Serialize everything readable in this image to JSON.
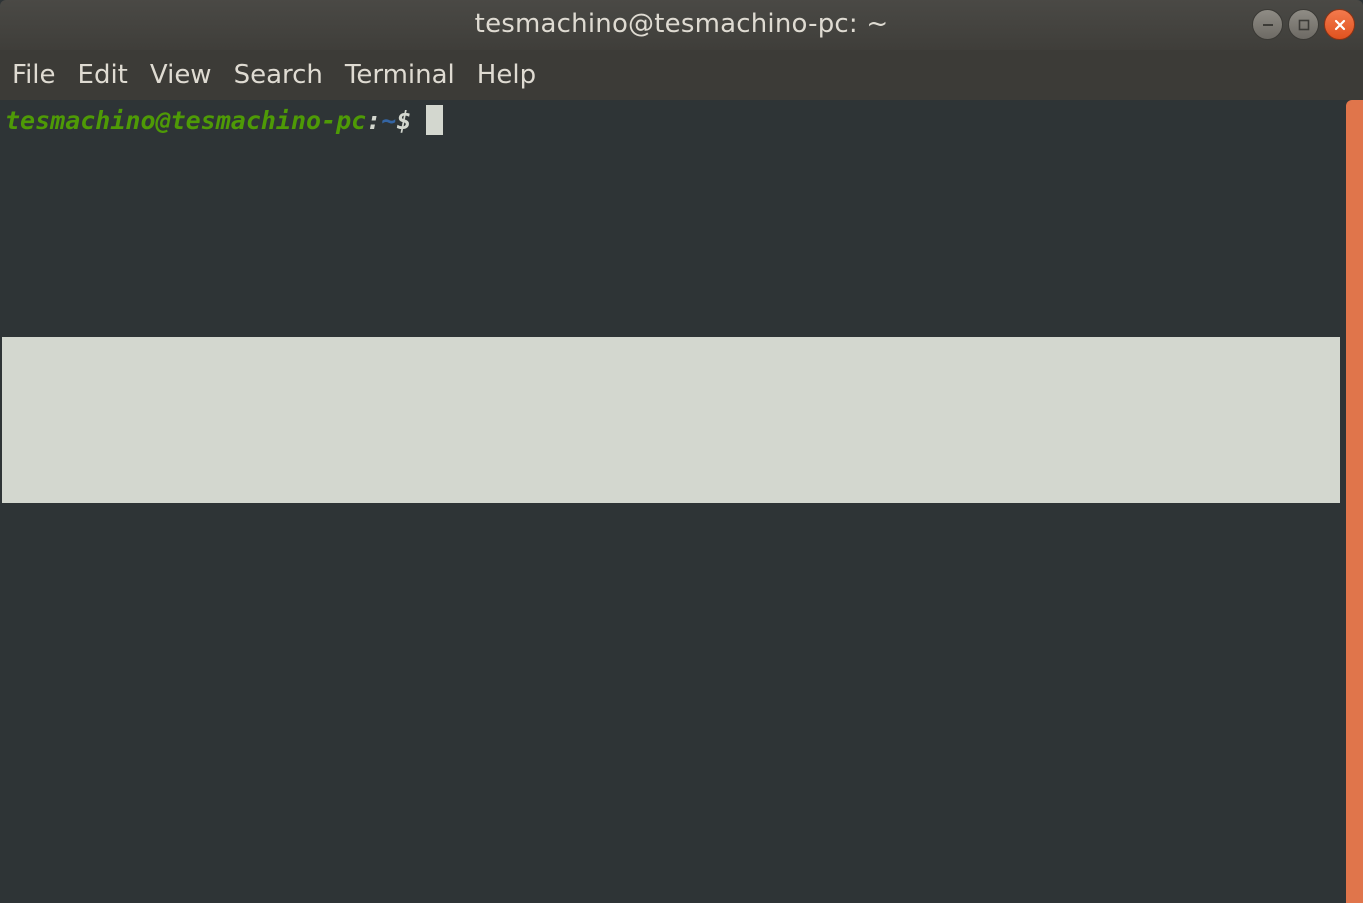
{
  "window": {
    "title": "tesmachino@tesmachino-pc: ~",
    "controls": {
      "minimize_icon": "minimize-icon",
      "maximize_icon": "maximize-icon",
      "close_icon": "close-icon"
    }
  },
  "menu": {
    "file": "File",
    "edit": "Edit",
    "view": "View",
    "search": "Search",
    "terminal": "Terminal",
    "help": "Help"
  },
  "terminal": {
    "prompt_user_host": "tesmachino@tesmachino-pc",
    "prompt_colon": ":",
    "prompt_path": "~",
    "prompt_symbol": "$"
  },
  "colors": {
    "background": "#2e3436",
    "prompt_user": "#4e9a06",
    "prompt_path": "#3465a4",
    "scrollbar_accent": "#e0754b",
    "close_button": "#e95420",
    "overlay_band": "#d3d7cf"
  }
}
